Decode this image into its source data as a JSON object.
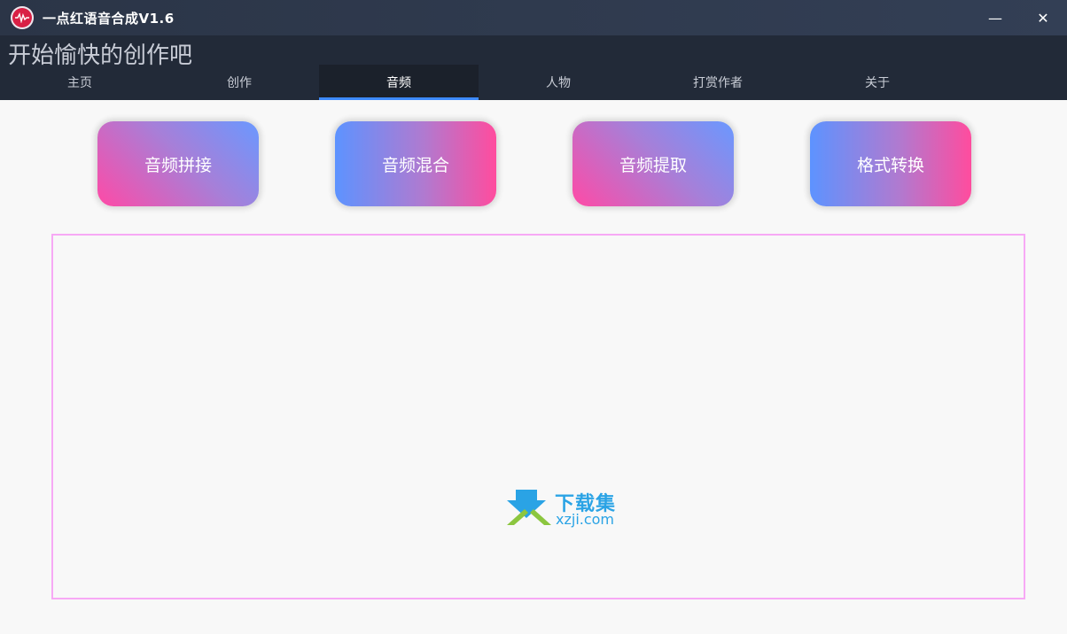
{
  "window": {
    "title": "一点红语音合成V1.6",
    "controls": {
      "minimize": "—",
      "close": "✕"
    }
  },
  "header": {
    "slogan": "开始愉快的创作吧"
  },
  "tabs": [
    {
      "label": "主页",
      "active": false
    },
    {
      "label": "创作",
      "active": false
    },
    {
      "label": "音频",
      "active": true
    },
    {
      "label": "人物",
      "active": false
    },
    {
      "label": "打赏作者",
      "active": false
    },
    {
      "label": "关于",
      "active": false
    }
  ],
  "tools": [
    {
      "label": "音频拼接"
    },
    {
      "label": "音频混合"
    },
    {
      "label": "音频提取"
    },
    {
      "label": "格式转换"
    }
  ],
  "watermark": {
    "text_cn": "下载集",
    "text_en": "xzji.com"
  },
  "colors": {
    "accent": "#3d8bff",
    "panel_border": "#f7a9f5",
    "gradient_pink": "#ff4aa6",
    "gradient_blue": "#6a98ff"
  }
}
